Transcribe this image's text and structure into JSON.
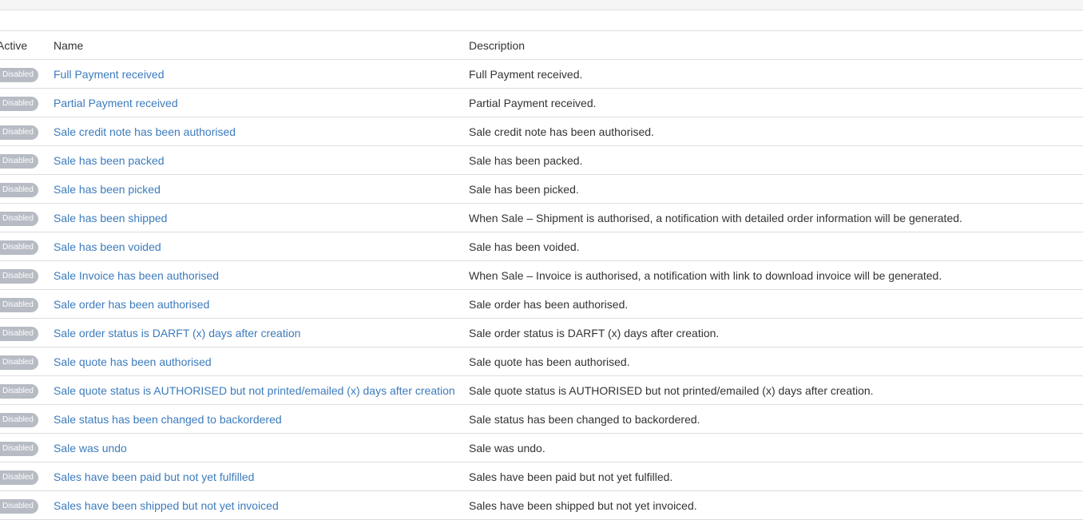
{
  "table": {
    "headers": {
      "active": "Active",
      "name": "Name",
      "description": "Description"
    },
    "status_color": "#b7bbc3",
    "link_color": "#3c7bbd",
    "rows": [
      {
        "status": "Disabled",
        "name": "Full Payment received",
        "description": "Full Payment received."
      },
      {
        "status": "Disabled",
        "name": "Partial Payment received",
        "description": "Partial Payment received."
      },
      {
        "status": "Disabled",
        "name": "Sale credit note has been authorised",
        "description": "Sale credit note has been authorised."
      },
      {
        "status": "Disabled",
        "name": "Sale has been packed",
        "description": "Sale has been packed."
      },
      {
        "status": "Disabled",
        "name": "Sale has been picked",
        "description": "Sale has been picked."
      },
      {
        "status": "Disabled",
        "name": "Sale has been shipped",
        "description": "When Sale – Shipment is authorised, a notification with detailed order information will be generated."
      },
      {
        "status": "Disabled",
        "name": "Sale has been voided",
        "description": "Sale has been voided."
      },
      {
        "status": "Disabled",
        "name": "Sale Invoice has been authorised",
        "description": "When Sale – Invoice is authorised, a notification with link to download invoice will be generated."
      },
      {
        "status": "Disabled",
        "name": "Sale order has been authorised",
        "description": "Sale order has been authorised."
      },
      {
        "status": "Disabled",
        "name": "Sale order status is DARFT (x) days after creation",
        "description": "Sale order status is DARFT (x) days after creation."
      },
      {
        "status": "Disabled",
        "name": "Sale quote has been authorised",
        "description": "Sale quote has been authorised."
      },
      {
        "status": "Disabled",
        "name": "Sale quote status is AUTHORISED but not printed/emailed (x) days after creation",
        "description": "Sale quote status is AUTHORISED but not printed/emailed (x) days after creation."
      },
      {
        "status": "Disabled",
        "name": "Sale status has been changed to backordered",
        "description": "Sale status has been changed to backordered."
      },
      {
        "status": "Disabled",
        "name": "Sale was undo",
        "description": "Sale was undo."
      },
      {
        "status": "Disabled",
        "name": "Sales have been paid but not yet fulfilled",
        "description": "Sales have been paid but not yet fulfilled."
      },
      {
        "status": "Disabled",
        "name": "Sales have been shipped but not yet invoiced",
        "description": "Sales have been shipped but not yet invoiced."
      }
    ]
  }
}
